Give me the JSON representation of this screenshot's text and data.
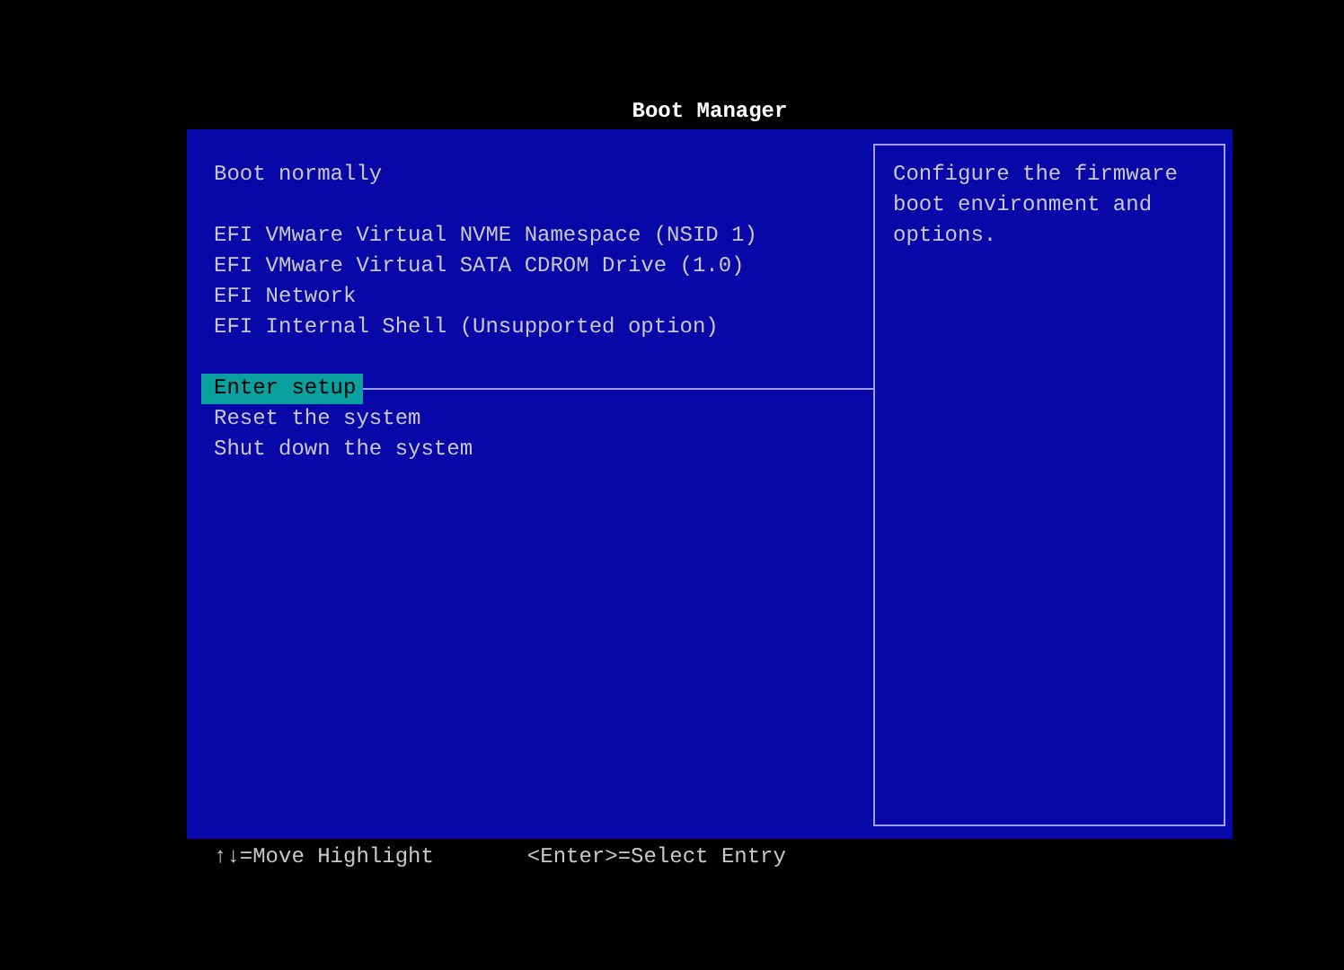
{
  "window": {
    "title": "Boot Manager"
  },
  "menu": [
    {
      "items": [
        {
          "label": "Boot normally",
          "selected": false
        }
      ]
    },
    {
      "items": [
        {
          "label": "EFI VMware Virtual NVME Namespace (NSID 1)",
          "selected": false
        },
        {
          "label": "EFI VMware Virtual SATA CDROM Drive (1.0)",
          "selected": false
        },
        {
          "label": "EFI Network",
          "selected": false
        },
        {
          "label": "EFI Internal Shell (Unsupported option)",
          "selected": false
        }
      ]
    },
    {
      "items": [
        {
          "label": "Enter setup",
          "selected": true
        },
        {
          "label": "Reset the system",
          "selected": false
        },
        {
          "label": "Shut down the system",
          "selected": false
        }
      ]
    }
  ],
  "help_text": "Configure the firmware boot environment and options.",
  "status_bar": [
    "↑↓=Move Highlight",
    "<Enter>=Select Entry"
  ]
}
